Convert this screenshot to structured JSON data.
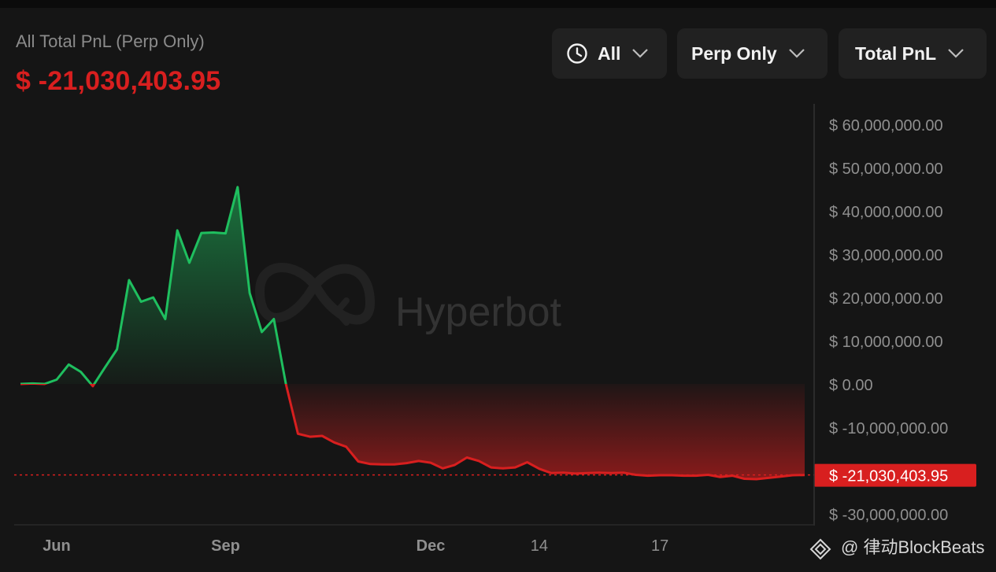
{
  "header": {
    "title": "All Total PnL (Perp Only)",
    "value": "$ -21,030,403.95"
  },
  "filters": [
    {
      "label": "All",
      "icon": "clock-icon"
    },
    {
      "label": "Perp Only",
      "icon": "chevron-down-icon"
    },
    {
      "label": "Total PnL",
      "icon": "chevron-down-icon"
    }
  ],
  "watermark": {
    "text": "Hyperbot"
  },
  "footer_watermark": {
    "text": "@ 律动BlockBeats"
  },
  "colors": {
    "positive": "#1fbf5f",
    "negative": "#d81f1f",
    "background": "#151515",
    "axis_text": "#8f8f8f"
  },
  "chart_data": {
    "type": "area",
    "title": "",
    "xlabel": "",
    "ylabel": "",
    "ylim": [
      -30000000,
      60000000
    ],
    "yticks": [
      60000000,
      50000000,
      40000000,
      30000000,
      20000000,
      10000000,
      0,
      -10000000,
      -30000000
    ],
    "ytick_labels": [
      "$ 60,000,000.00",
      "$ 50,000,000.00",
      "$ 40,000,000.00",
      "$ 30,000,000.00",
      "$ 20,000,000.00",
      "$ 10,000,000.00",
      "$ 0.00",
      "$ -10,000,000.00",
      "$ -30,000,000.00"
    ],
    "xticks": [
      {
        "label": "Jun",
        "index": 3
      },
      {
        "label": "Sep",
        "index": 17
      },
      {
        "label": "Dec",
        "index": 34
      },
      {
        "label": "14",
        "index": 43
      },
      {
        "label": "17",
        "index": 53
      }
    ],
    "current_value": -21030403.95,
    "current_label": "$ -21,030,403.95",
    "series": [
      {
        "values": [
          0,
          100000,
          0,
          1000000,
          4500000,
          2800000,
          -500000,
          3800000,
          8000000,
          24000000,
          19000000,
          20000000,
          15000000,
          35500000,
          28000000,
          34900000,
          35000000,
          34800000,
          45500000,
          21000000,
          12000000,
          15000000,
          0,
          -11500000,
          -12200000,
          -12000000,
          -13500000,
          -14500000,
          -17900000,
          -18500000,
          -18600000,
          -18600000,
          -18300000,
          -17800000,
          -18200000,
          -19500000,
          -18700000,
          -17000000,
          -17800000,
          -19300000,
          -19500000,
          -19300000,
          -18100000,
          -19600000,
          -20600000,
          -20500000,
          -20700000,
          -20600000,
          -20500000,
          -20600000,
          -20500000,
          -21000000,
          -21200000,
          -21100000,
          -21100000,
          -21200000,
          -21200000,
          -21000000,
          -21500000,
          -21200000,
          -21900000,
          -22000000,
          -21700000,
          -21400000,
          -21100000,
          -21030403.95
        ]
      }
    ]
  }
}
